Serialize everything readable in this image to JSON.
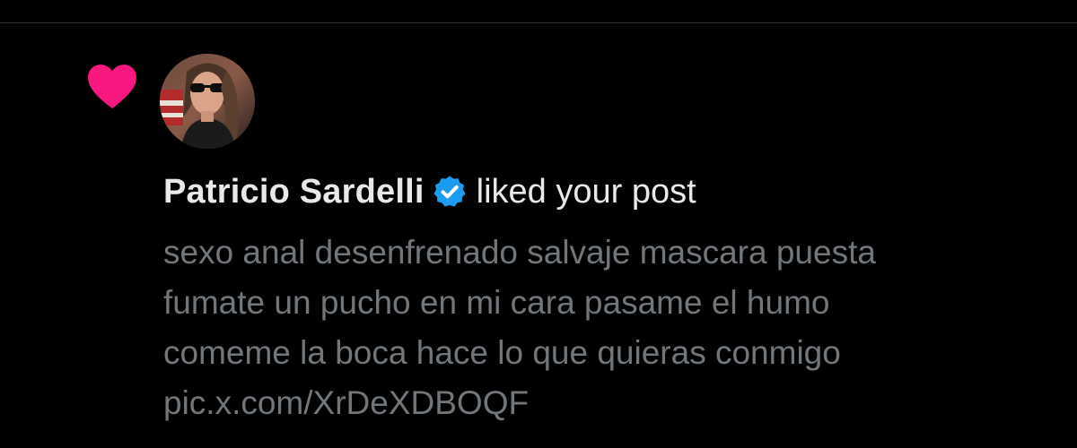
{
  "notification": {
    "type_icon": "heart-icon",
    "type_color": "#f91880",
    "actor": {
      "name": "Patricio Sardelli",
      "verified": true,
      "verified_color": "#1d9bf0",
      "avatar": "avatar"
    },
    "action": "liked your post",
    "post_lines": [
      "sexo anal desenfrenado salvaje mascara puesta",
      "fumate un pucho en mi cara pasame el humo",
      "comeme la boca hace lo que quieras conmigo",
      "pic.x.com/XrDeXDBOQF"
    ]
  },
  "colors": {
    "background": "#000000",
    "primary_text": "#e7e9ea",
    "secondary_text": "#71767b",
    "divider": "#2f3336"
  }
}
